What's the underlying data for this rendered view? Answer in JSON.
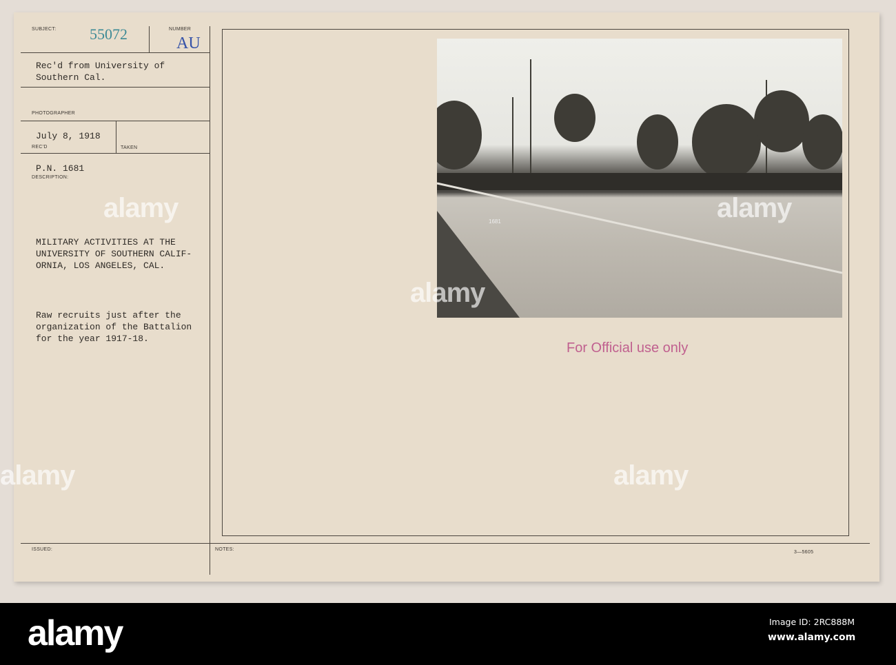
{
  "card": {
    "subject_label": "SUBJECT:",
    "subject_number": "55072",
    "number_label": "NUMBER",
    "number_value": "AU",
    "received_from": "Rec'd from University of\nSouthern Cal.",
    "photographer_label": "PHOTOGRAPHER",
    "date": "July 8, 1918",
    "recd_label": "REC'D",
    "taken_label": "TAKEN",
    "pn": "P.N. 1681",
    "description_label": "DESCRIPTION:",
    "title": "MILITARY ACTIVITIES AT THE\nUNIVERSITY OF SOUTHERN CALIF-\nORNIA, LOS ANGELES, CAL.",
    "caption": "Raw recruits just after the\norganization of the Battalion\nfor the year 1917-18.",
    "issued_label": "ISSUED:",
    "notes_label": "NOTES:",
    "stamp": "For Official use only",
    "form_code": "3—5605",
    "photo_number": "1681"
  },
  "watermark": "alamy",
  "footer": {
    "brand": "alamy",
    "image_id": "Image ID: 2RC888M",
    "url": "www.alamy.com"
  },
  "colors": {
    "subject_number": "#3d8a96",
    "number_value": "#3552a8",
    "stamp": "#c0608f"
  }
}
